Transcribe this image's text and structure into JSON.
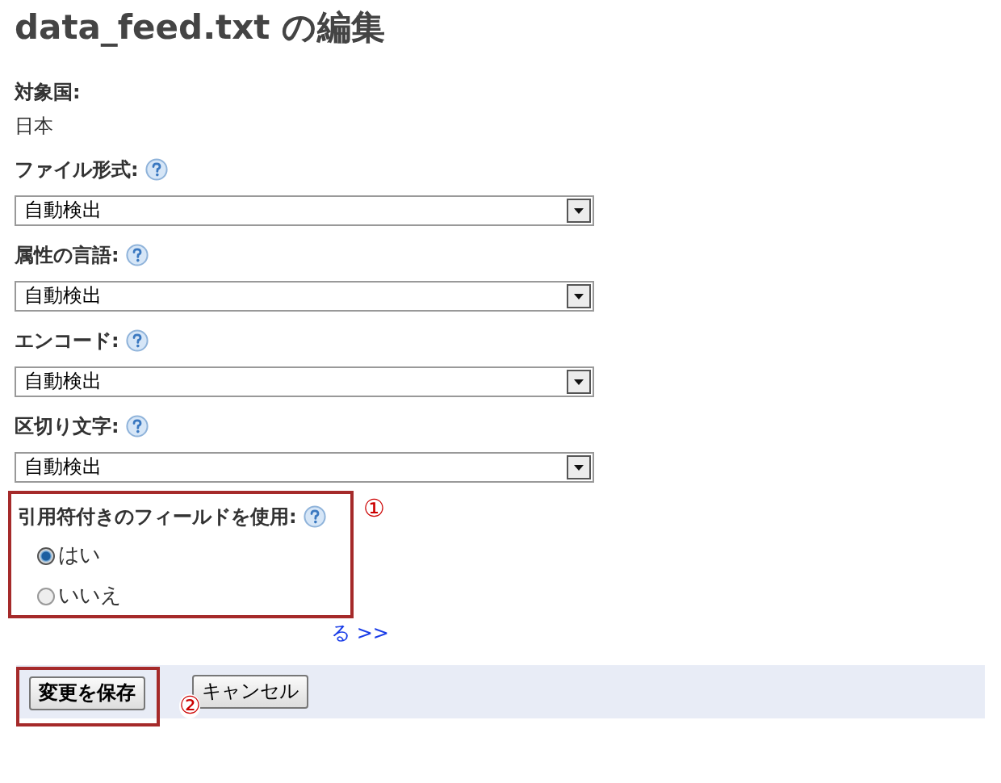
{
  "title": "data_feed.txt の編集",
  "country": {
    "label": "対象国:",
    "value": "日本"
  },
  "selects": [
    {
      "label": "ファイル形式:",
      "value": "自動検出"
    },
    {
      "label": "属性の言語:",
      "value": "自動検出"
    },
    {
      "label": "エンコード:",
      "value": "自動検出"
    },
    {
      "label": "区切り文字:",
      "value": "自動検出"
    }
  ],
  "quoted_fields": {
    "label": "引用符付きのフィールドを使用:",
    "callout": "①",
    "options": [
      {
        "label": "はい",
        "selected": true
      },
      {
        "label": "いいえ",
        "selected": false
      }
    ]
  },
  "link": "る >>",
  "buttons": [
    {
      "label": "変更を保存",
      "kind": "primary"
    },
    {
      "label": "キャンセル",
      "kind": "secondary"
    }
  ],
  "save_callout": "②"
}
